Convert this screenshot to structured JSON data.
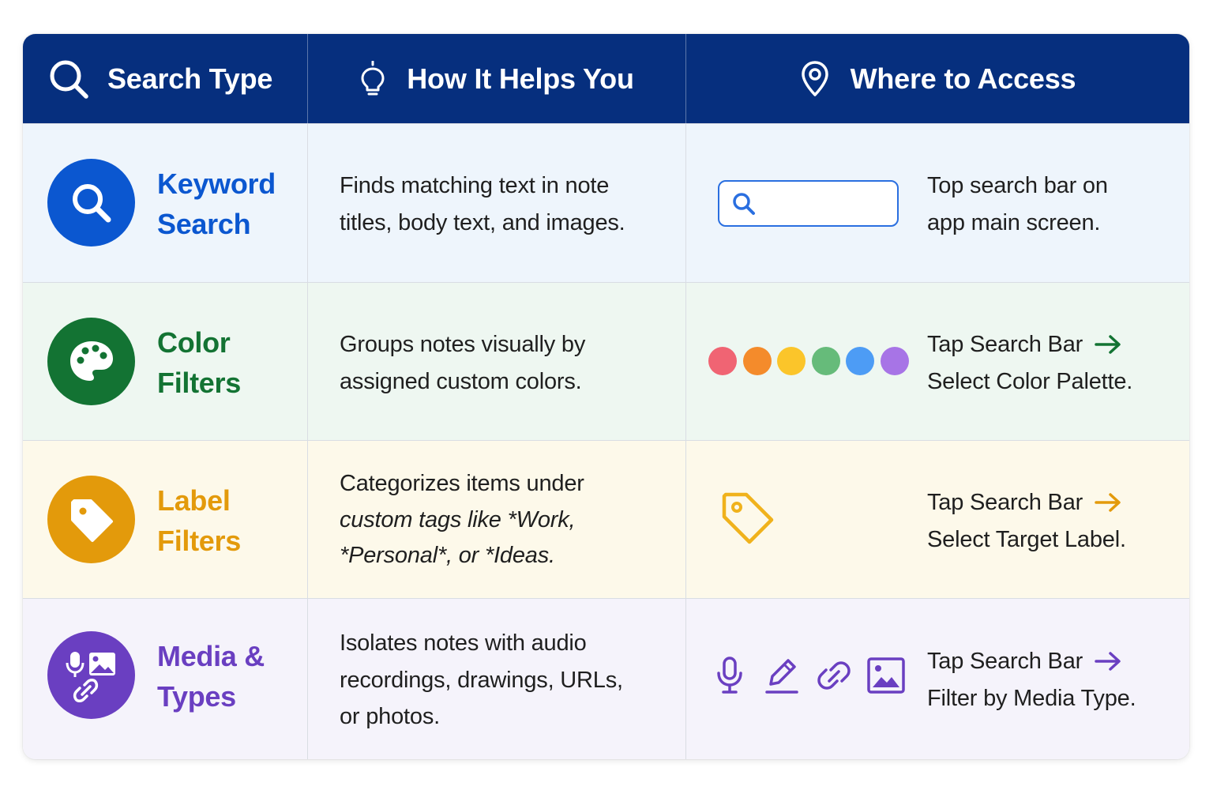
{
  "header": {
    "col1": "Search Type",
    "col2": "How It Helps You",
    "col3": "Where to Access"
  },
  "rows": [
    {
      "title_line1": "Keyword",
      "title_line2": "Search",
      "color": "#0b57d0",
      "bg": "#eef5fc",
      "icon": "search-icon",
      "desc_line1": "Finds matching text in note",
      "desc_line2": "titles, body text, and images.",
      "access_line1": "Top search bar on",
      "access_line2": "app main screen."
    },
    {
      "title_line1": "Color",
      "title_line2": "Filters",
      "color": "#137333",
      "bg": "#eef7f1",
      "icon": "palette-icon",
      "desc_line1": "Groups notes visually by",
      "desc_line2": "assigned custom colors.",
      "access_line1": "Tap Search Bar",
      "access_line2": "Select Color Palette.",
      "palette": [
        "#f06473",
        "#f48b2b",
        "#fbc52a",
        "#66bb7a",
        "#4d9cf5",
        "#a774e6"
      ]
    },
    {
      "title_line1": "Label",
      "title_line2": "Filters",
      "color": "#e39a0b",
      "bg": "#fdf9ea",
      "icon": "label-icon",
      "desc_line1": "Categorizes items under",
      "desc_line2": "custom tags like *Work,",
      "desc_line3": "*Personal*, or *Ideas.",
      "access_line1": "Tap Search Bar",
      "access_line2": "Select Target Label."
    },
    {
      "title_line1": "Media &",
      "title_line2": "Types",
      "color": "#6a3fc1",
      "bg": "#f5f3fb",
      "icon": "media-icon",
      "desc_line1": "Isolates notes with audio",
      "desc_line2": "recordings, drawings, URLs,",
      "desc_line3": "or photos.",
      "access_line1": "Tap Search Bar",
      "access_line2": "Filter by Media Type."
    }
  ]
}
